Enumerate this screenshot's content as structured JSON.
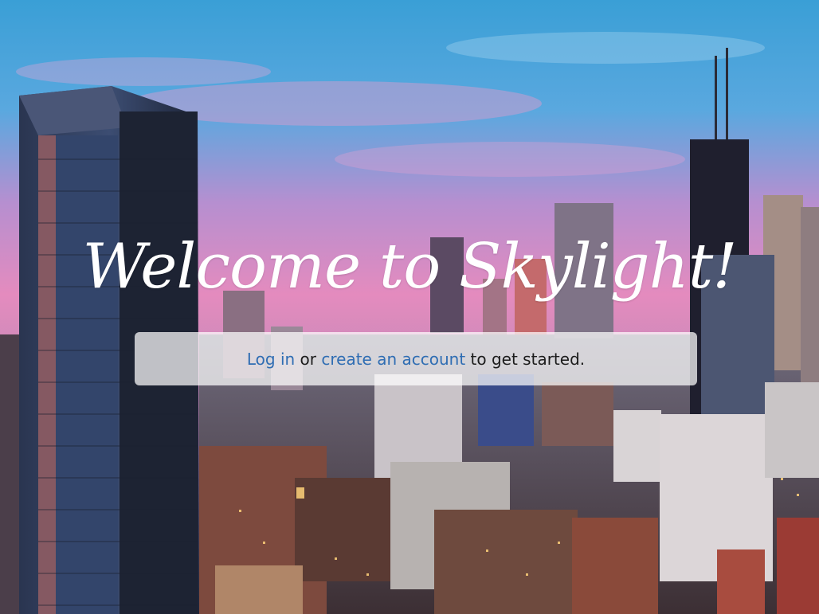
{
  "hero": {
    "title": "Welcome to Skylight!",
    "cta": {
      "login_link": "Log in",
      "connector": " or ",
      "signup_link": "create an account",
      "suffix": " to get started."
    }
  },
  "colors": {
    "link": "#2f6db3",
    "sky_top": "#3fa7d8",
    "sky_pink": "#e78cb8",
    "title": "#ffffff"
  }
}
